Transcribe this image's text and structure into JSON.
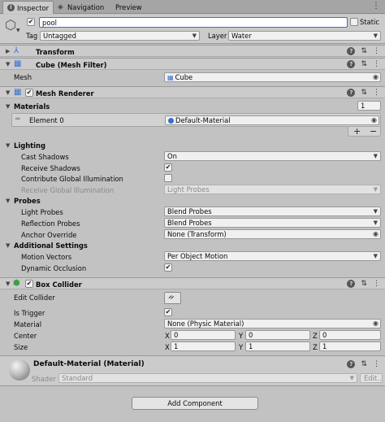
{
  "tabs": [
    {
      "label": "Inspector"
    },
    {
      "label": "Navigation"
    },
    {
      "label": "Preview"
    }
  ],
  "object": {
    "name": "pool",
    "static_label": "Static",
    "tag_label": "Tag",
    "tag_value": "Untagged",
    "layer_label": "Layer",
    "layer_value": "Water"
  },
  "transform": {
    "title": "Transform"
  },
  "mesh_filter": {
    "title": "Cube (Mesh Filter)",
    "mesh_label": "Mesh",
    "mesh_value": "Cube"
  },
  "mesh_renderer": {
    "title": "Mesh Renderer",
    "materials_label": "Materials",
    "materials_count": "1",
    "element_label": "Element 0",
    "element_value": "Default-Material",
    "add_symbol": "+",
    "remove_symbol": "−",
    "lighting_label": "Lighting",
    "cast_shadows_label": "Cast Shadows",
    "cast_shadows_value": "On",
    "receive_shadows_label": "Receive Shadows",
    "contribute_gi_label": "Contribute Global Illumination",
    "receive_gi_label": "Receive Global Illumination",
    "receive_gi_value": "Light Probes",
    "probes_label": "Probes",
    "light_probes_label": "Light Probes",
    "light_probes_value": "Blend Probes",
    "reflection_probes_label": "Reflection Probes",
    "reflection_probes_value": "Blend Probes",
    "anchor_override_label": "Anchor Override",
    "anchor_override_value": "None (Transform)",
    "additional_label": "Additional Settings",
    "motion_vectors_label": "Motion Vectors",
    "motion_vectors_value": "Per Object Motion",
    "dynamic_occlusion_label": "Dynamic Occlusion"
  },
  "box_collider": {
    "title": "Box Collider",
    "edit_collider_label": "Edit Collider",
    "is_trigger_label": "Is Trigger",
    "material_label": "Material",
    "material_value": "None (Physic Material)",
    "center_label": "Center",
    "size_label": "Size",
    "x": "X",
    "y": "Y",
    "z": "Z",
    "center": [
      "0",
      "0",
      "0"
    ],
    "size": [
      "1",
      "1",
      "1"
    ]
  },
  "material": {
    "title": "Default-Material (Material)",
    "shader_label": "Shader",
    "shader_value": "Standard",
    "edit_label": "Edit..."
  },
  "add_component_label": "Add Component"
}
